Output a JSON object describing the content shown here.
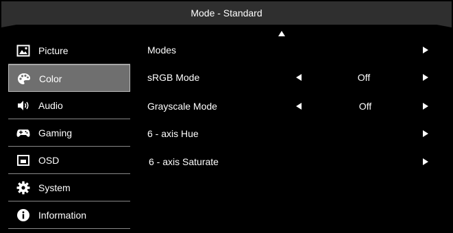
{
  "header": {
    "title": "Mode - Standard"
  },
  "sidebar": {
    "items": [
      {
        "label": "Picture",
        "icon": "picture-icon",
        "active": false
      },
      {
        "label": "Color",
        "icon": "palette-icon",
        "active": true
      },
      {
        "label": "Audio",
        "icon": "speaker-icon",
        "active": false
      },
      {
        "label": "Gaming",
        "icon": "gamepad-icon",
        "active": false
      },
      {
        "label": "OSD",
        "icon": "osd-icon",
        "active": false
      },
      {
        "label": "System",
        "icon": "gear-icon",
        "active": false
      },
      {
        "label": "Information",
        "icon": "info-icon",
        "active": false
      }
    ]
  },
  "main": {
    "rows": [
      {
        "label": "Modes",
        "value": ""
      },
      {
        "label": "sRGB Mode",
        "value": "Off"
      },
      {
        "label": "Grayscale Mode",
        "value": "Off"
      },
      {
        "label": "6 - axis Hue",
        "value": ""
      },
      {
        "label": "6 - axis Saturate",
        "value": ""
      }
    ]
  },
  "colors": {
    "background": "#000000",
    "header": "#2f2f2f",
    "selected": "#6f6f6f",
    "text": "#ffffff"
  }
}
